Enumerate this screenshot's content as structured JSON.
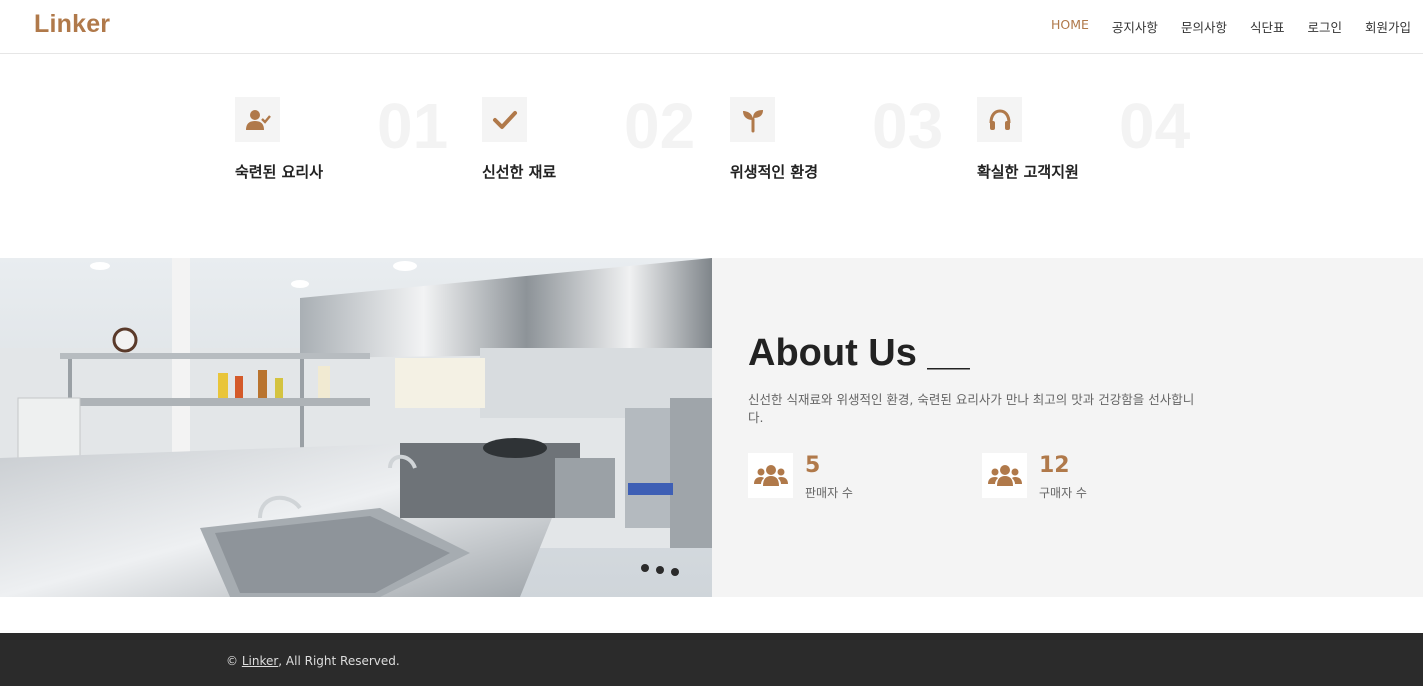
{
  "header": {
    "logo": "Linker",
    "nav": [
      {
        "label": "HOME",
        "active": true
      },
      {
        "label": "공지사항"
      },
      {
        "label": "문의사항"
      },
      {
        "label": "식단표"
      },
      {
        "label": "로그인"
      },
      {
        "label": "회원가입"
      }
    ]
  },
  "features": [
    {
      "icon": "user-check-icon",
      "number": "01",
      "title": "숙련된 요리사"
    },
    {
      "icon": "check-icon",
      "number": "02",
      "title": "신선한 재료"
    },
    {
      "icon": "seedling-icon",
      "number": "03",
      "title": "위생적인 환경"
    },
    {
      "icon": "headphones-icon",
      "number": "04",
      "title": "확실한 고객지원"
    }
  ],
  "about": {
    "title": "About Us __",
    "description": "신선한 식재료와 위생적인 환경, 숙련된 요리사가 만나 최고의 맛과 건강함을 선사합니다.",
    "stats": [
      {
        "icon": "users-icon",
        "value": "5",
        "label": "판매자 수"
      },
      {
        "icon": "users-icon",
        "value": "12",
        "label": "구매자 수"
      }
    ]
  },
  "footer": {
    "copyright_prefix": "© ",
    "brand_link": "Linker",
    "copyright_suffix": ", All Right Reserved."
  },
  "colors": {
    "accent": "#b0794a",
    "footer_bg": "#2b2b2b",
    "about_bg": "#f4f4f4"
  }
}
